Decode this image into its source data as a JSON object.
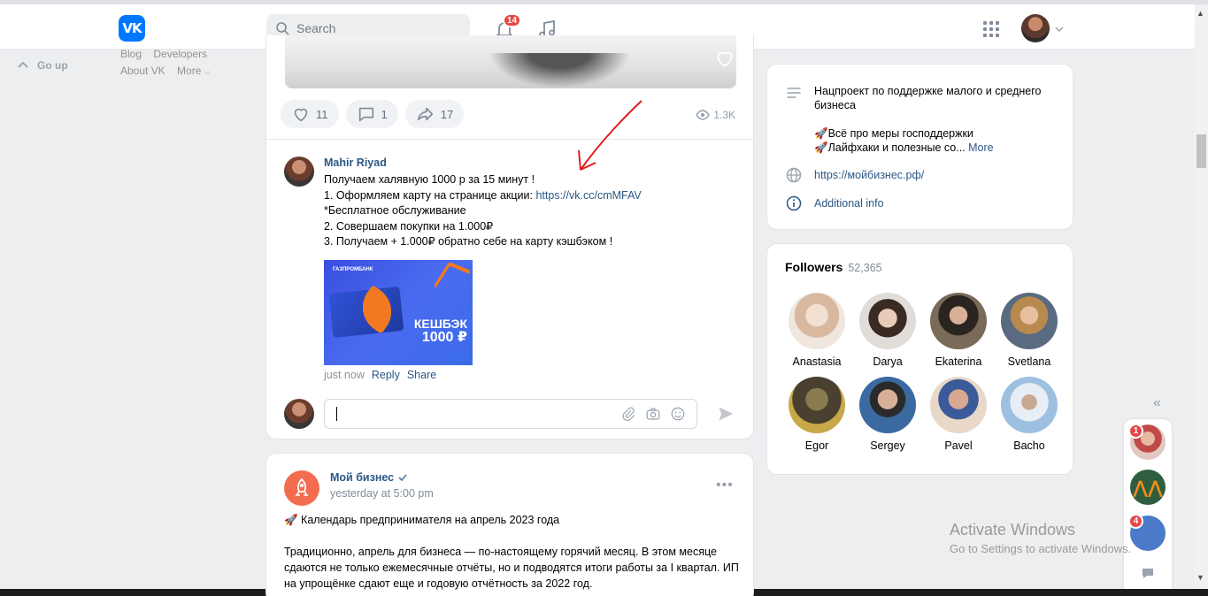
{
  "header": {
    "search_placeholder": "Search",
    "notifications_count": "14"
  },
  "left_nav": {
    "go_up": "Go up",
    "links_row1": [
      "Blog",
      "Developers"
    ],
    "links_row2": [
      "About VK",
      "More"
    ]
  },
  "post1": {
    "likes": "11",
    "comments": "1",
    "shares": "17",
    "views": "1.3K"
  },
  "comment": {
    "author": "Mahir Riyad",
    "lines": [
      "Получаем халявную 1000 р за 15 минут !",
      "1. Оформляем карту на странице акции: ",
      "*Бесплатное обслуживание",
      "2. Совершаем покупки на 1.000₽",
      "3. Получаем + 1.000₽ обратно себе на карту кэшбэком !"
    ],
    "link": "https://vk.cc/cmMFAV",
    "banner_brand": "ГАЗПРОМБАНК",
    "banner_text_1": "КЕШБЭК",
    "banner_text_2": "1000 ₽",
    "time": "just now",
    "reply": "Reply",
    "share": "Share"
  },
  "post2": {
    "author": "Мой бизнес",
    "time": "yesterday at 5:00 pm",
    "headline": "🚀 Календарь предпринимателя на апрель 2023 года",
    "body": "Традиционно, апрель для бизнеса — по-настоящему горячий месяц. В этом месяце сдаются не только ежемесячные отчёты, но и подводятся итоги работы за I квартал. ИП на упрощёнке сдают еще и годовую отчётность за 2022 год."
  },
  "info": {
    "description": "Нацпроект по поддержке малого и среднего бизнеса",
    "line1": "🚀Всё про меры господдержки",
    "line2": "🚀Лайфхаки и полезные со...",
    "more": "More",
    "website": "https://мойбизнес.рф/",
    "additional": "Additional info"
  },
  "followers": {
    "title": "Followers",
    "count": "52,365",
    "items": [
      {
        "name": "Anastasia",
        "color": "#e8d2c4"
      },
      {
        "name": "Darya",
        "color": "#d9cfcb"
      },
      {
        "name": "Ekaterina",
        "color": "#6b5a4a"
      },
      {
        "name": "Svetlana",
        "color": "#8a7a5a"
      },
      {
        "name": "Egor",
        "color": "#5a5038"
      },
      {
        "name": "Sergey",
        "color": "#4a6a8a"
      },
      {
        "name": "Pavel",
        "color": "#c8a890"
      },
      {
        "name": "Bacho",
        "color": "#a8c0d8"
      }
    ]
  },
  "chats": {
    "badge1": "1",
    "badge2": "4"
  },
  "windows": {
    "activate_title": "Activate Windows",
    "activate_sub": "Go to Settings to activate Windows."
  },
  "colors": {
    "vk_blue": "#0077ff",
    "link": "#2a5885",
    "badge_red": "#e64646"
  }
}
